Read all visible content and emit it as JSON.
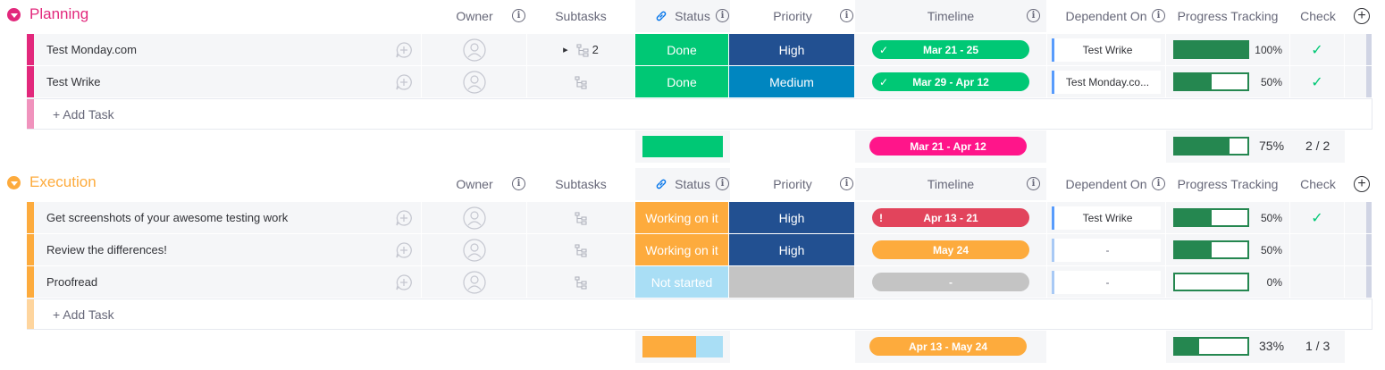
{
  "columns": {
    "owner": "Owner",
    "subtasks": "Subtasks",
    "status": "Status",
    "priority": "Priority",
    "timeline": "Timeline",
    "dependent": "Dependent On",
    "progress": "Progress Tracking",
    "check": "Check"
  },
  "groups": [
    {
      "title": "Planning",
      "color": "#e2287c",
      "items": [
        {
          "name": "Test Monday.com",
          "subtasks": "2",
          "status": "Done",
          "status_color": "#00c875",
          "priority": "High",
          "priority_color": "#225091",
          "timeline": "Mar 21 - 25",
          "timeline_color": "#00c875",
          "timeline_mark": "✓",
          "dependent": "Test Wrike",
          "progress": 1.0,
          "progress_label": "100%",
          "check": "✓"
        },
        {
          "name": "Test Wrike",
          "subtasks": "",
          "status": "Done",
          "status_color": "#00c875",
          "priority": "Medium",
          "priority_color": "#0086c0",
          "timeline": "Mar 29 - Apr 12",
          "timeline_color": "#00c875",
          "timeline_mark": "✓",
          "dependent": "Test Monday.co...",
          "progress": 0.5,
          "progress_label": "50%",
          "check": "✓"
        }
      ],
      "add_label": "+ Add Task",
      "summary": {
        "timeline": "Mar 21 - Apr 12",
        "timeline_color": "#ff158a",
        "progress": 0.75,
        "progress_label": "75%",
        "check": "2 / 2",
        "status_segments": [
          {
            "fraction": 1.0,
            "color": "#00c875"
          }
        ]
      }
    },
    {
      "title": "Execution",
      "color": "#fdab3d",
      "items": [
        {
          "name": "Get screenshots of your awesome testing work",
          "subtasks": "",
          "status": "Working on it",
          "status_color": "#fdab3d",
          "priority": "High",
          "priority_color": "#225091",
          "timeline": "Apr 13 - 21",
          "timeline_color": "#e2445c",
          "timeline_mark": "!",
          "dependent": "Test Wrike",
          "progress": 0.5,
          "progress_label": "50%",
          "check": "✓"
        },
        {
          "name": "Review the differences!",
          "subtasks": "",
          "status": "Working on it",
          "status_color": "#fdab3d",
          "priority": "High",
          "priority_color": "#225091",
          "timeline": "May 24",
          "timeline_color": "#fdab3d",
          "timeline_mark": "",
          "dependent": "-",
          "progress": 0.5,
          "progress_label": "50%",
          "check": ""
        },
        {
          "name": "Proofread",
          "subtasks": "",
          "status": "Not started",
          "status_color": "#a9def5",
          "priority": "",
          "priority_color": "#c4c4c4",
          "timeline": "-",
          "timeline_color": "#c4c4c4",
          "timeline_mark": "",
          "dependent": "-",
          "progress": 0.0,
          "progress_label": "0%",
          "check": ""
        }
      ],
      "add_label": "+ Add Task",
      "summary": {
        "timeline": "Apr 13 - May 24",
        "timeline_color": "#fdab3d",
        "progress": 0.33,
        "progress_label": "33%",
        "check": "1 / 3",
        "status_segments": [
          {
            "fraction": 0.67,
            "color": "#fdab3d"
          },
          {
            "fraction": 0.33,
            "color": "#a9def5"
          }
        ]
      }
    }
  ]
}
